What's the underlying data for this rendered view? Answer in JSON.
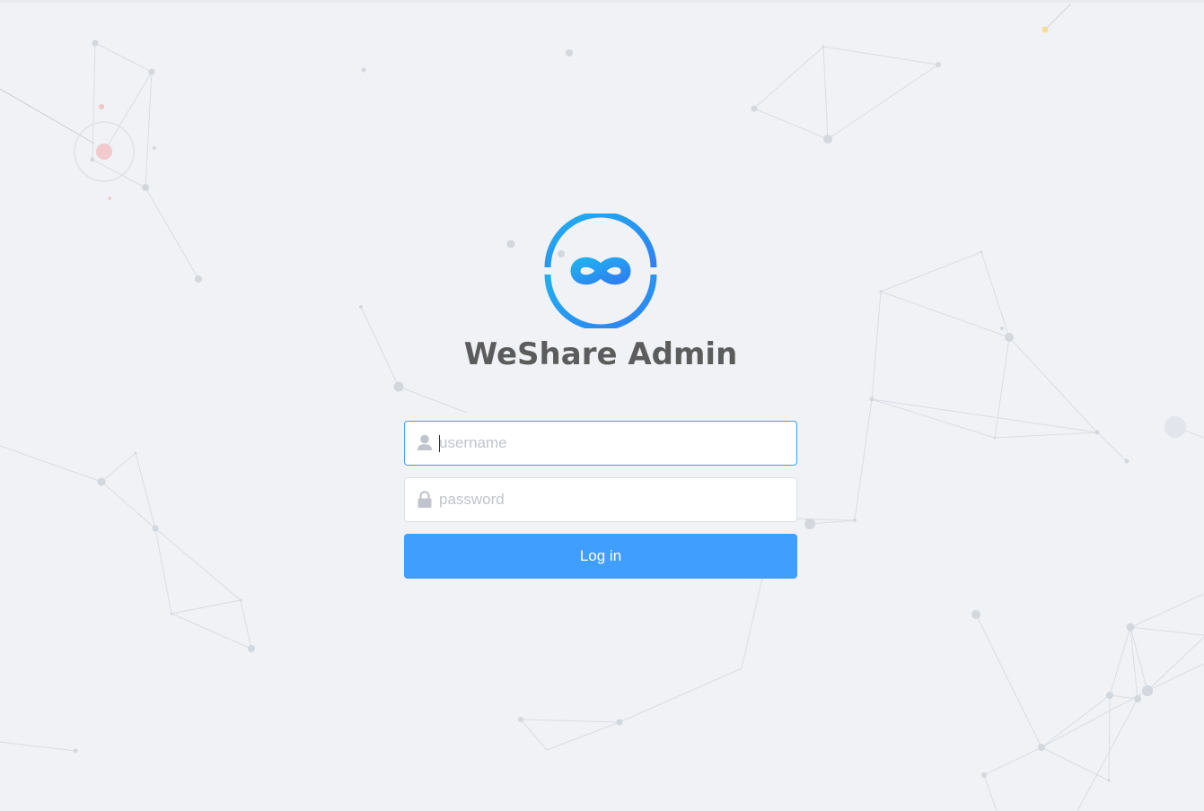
{
  "app": {
    "title": "WeShare Admin"
  },
  "form": {
    "username": {
      "placeholder": "username",
      "value": "",
      "icon": "user-icon"
    },
    "password": {
      "placeholder": "password",
      "value": "",
      "icon": "lock-icon"
    },
    "submit_label": "Log in"
  },
  "theme": {
    "accent": "#409eff",
    "background": "#f0f2f5",
    "logo_gradient": [
      "#1fb0ef",
      "#2f7ff2"
    ],
    "title_color": "#5c5c5c",
    "placeholder_color": "#c0c4cc"
  }
}
